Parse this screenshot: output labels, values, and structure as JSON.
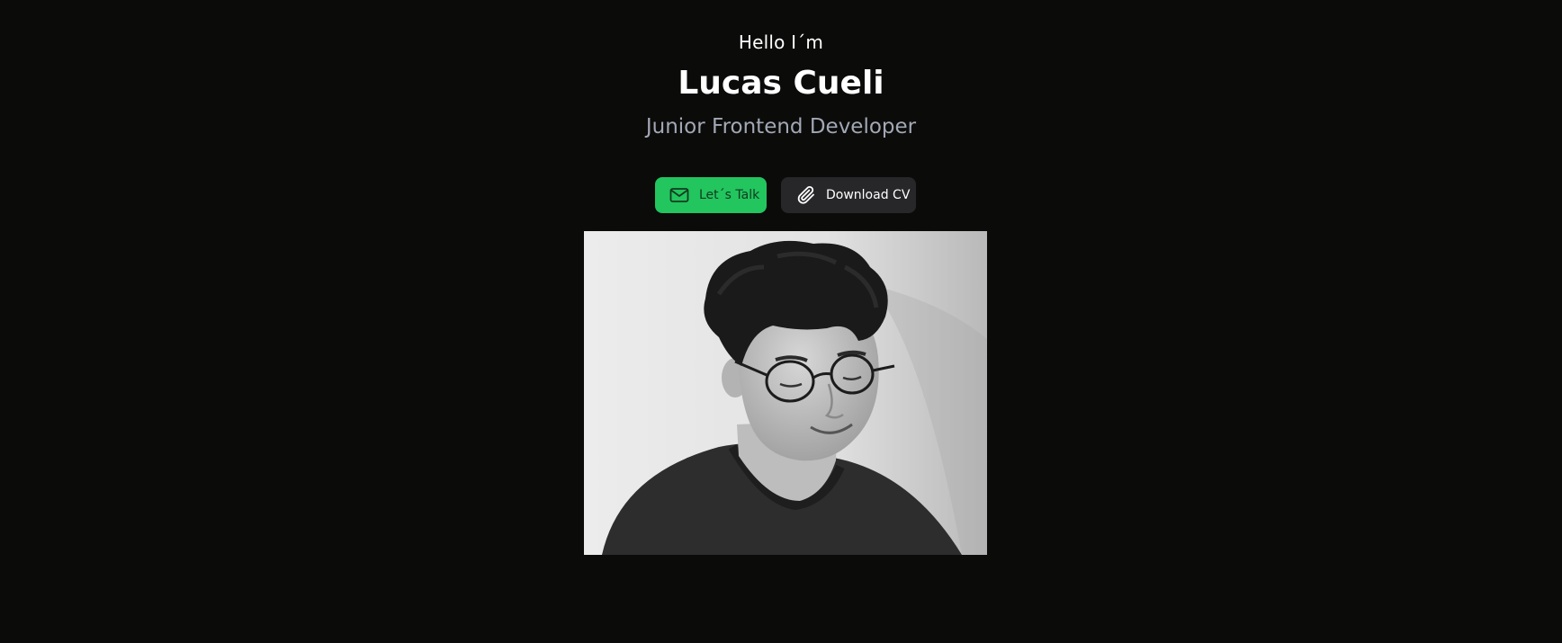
{
  "hero": {
    "greeting": "Hello I´m",
    "name": "Lucas Cueli",
    "role": "Junior Frontend Developer"
  },
  "buttons": {
    "talk": {
      "label": "Let´s Talk",
      "icon": "mail-icon",
      "color": "#22c55e"
    },
    "cv": {
      "label": "Download CV",
      "icon": "paperclip-icon",
      "color": "#27272a"
    }
  },
  "colors": {
    "background": "#0b0b0a",
    "accent": "#22c55e",
    "muted_text": "#a2a8b4"
  },
  "photo": {
    "description_icon": "portrait-photo"
  }
}
